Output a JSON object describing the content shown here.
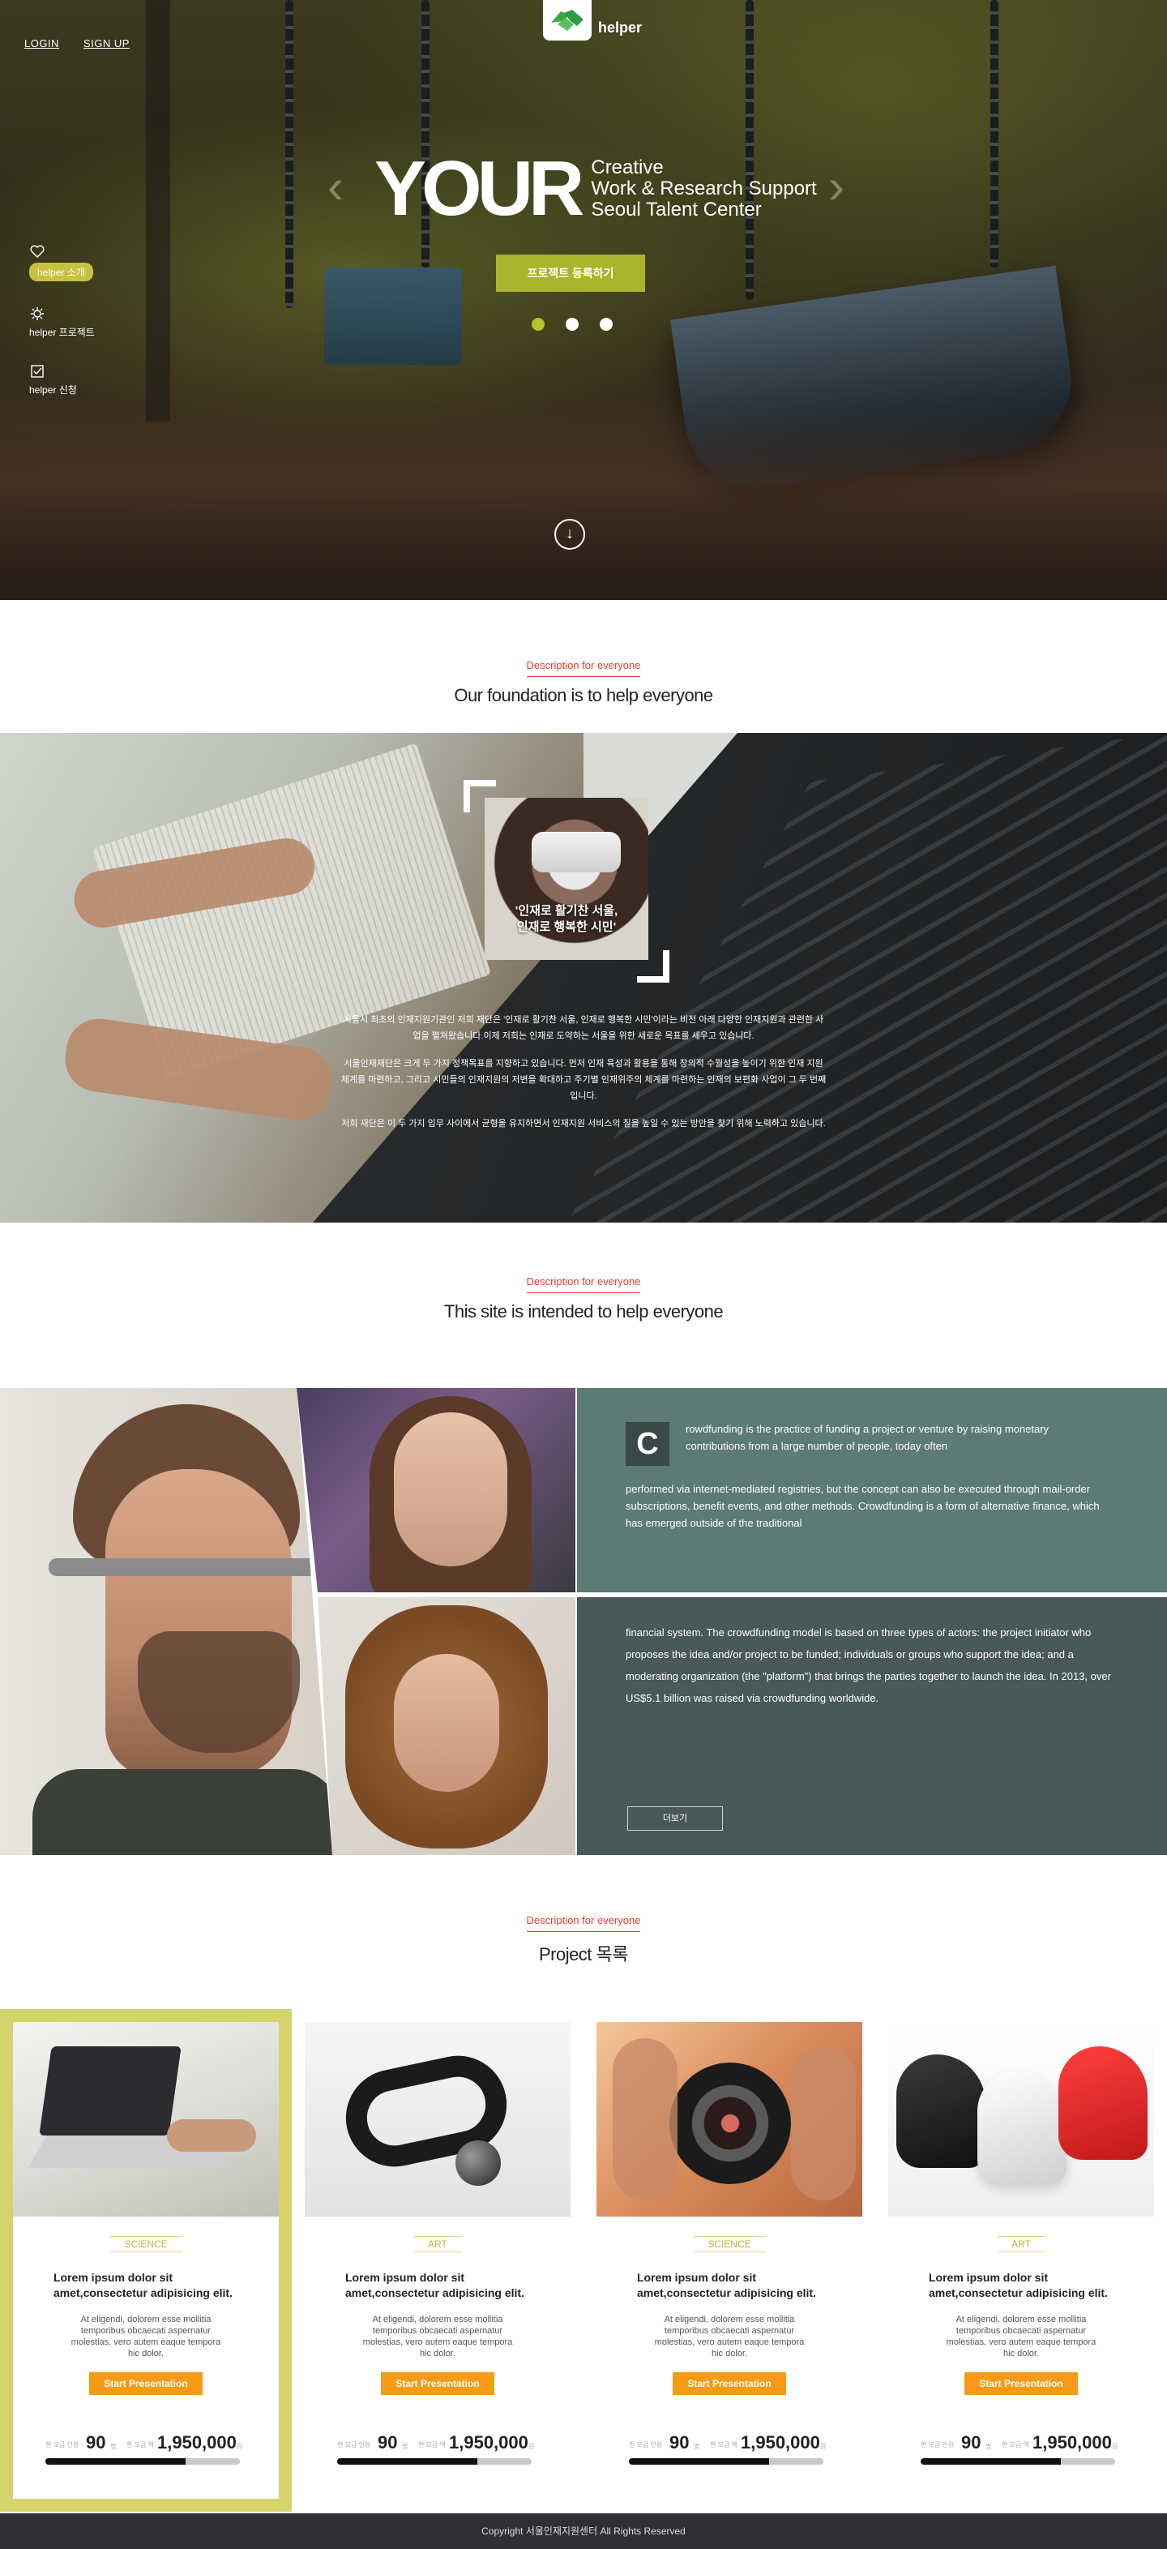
{
  "header": {
    "login": "LOGIN",
    "signup": "SIGN UP",
    "logo_text": "helper"
  },
  "side_nav": [
    {
      "label": "helper 소개",
      "icon": "heart-icon",
      "active": true
    },
    {
      "label": "helper 프로젝트",
      "icon": "gear-icon",
      "active": false
    },
    {
      "label": "helper 신청",
      "icon": "checkbox-icon",
      "active": false
    }
  ],
  "hero": {
    "big": "YOUR",
    "line1": "Creative",
    "line2": "Work & Research Support",
    "line3": "Seoul Talent Center",
    "cta": "프로젝트 등록하기",
    "prev_arrow": "‹",
    "next_arrow": "›",
    "scroll_icon": "↓",
    "active_slide": 1,
    "slide_count": 3
  },
  "section1": {
    "kicker": "Description for everyone",
    "title": "Our foundation is to help everyone",
    "photo_caption_line1": "'인재로 활기찬 서울,",
    "photo_caption_line2": "인재로 행복한 시민'",
    "paragraphs": [
      "서울시 최초의 인재지원기관인 저희 재단은 '인재로 활기찬 서울, 인재로 행복한 시민'이라는 비전 아래 다양한 인재지원과 관련한 사업을 펼쳐왔습니다.이제 저희는 인재로 도약하는 서울을 위한 새로운 목표를 세우고 있습니다.",
      "서울인재재단은 크게 두 가지 정책목표를 지향하고 있습니다. 먼저 인재 육성과 활용을 통해 창의적 수월성을 높이기 위한 인재 지원 체계를 마련하고, 그리고 시민들의 인재지원의 저변을 확대하고 주기별 인재위주의 체계를 마련하는 인재의 보편화 사업이 그 두 번째입니다.",
      "저희 재단은 이 두 가지 임무 사이에서 균형을 유지하면서 인재지원 서비스의 질을 높일 수 있는 방안을 찾기 위해 노력하고 있습니다."
    ]
  },
  "section2": {
    "kicker": "Description for everyone",
    "title": "This site is intended to help everyone",
    "drop_cap": "C",
    "lead": "rowdfunding is the practice of funding a project or venture by raising monetary contributions from a large number of people, today often",
    "rest": "performed via internet-mediated registries, but the concept can also be executed through mail-order subscriptions, benefit events, and other methods. Crowdfunding is a form of alternative finance, which has emerged outside of the traditional",
    "panel2": "financial system. The crowdfunding model is based on three types of actors: the project initiator who proposes the idea and/or project to be funded; individuals or groups who support the idea; and a moderating organization (the \"platform\") that brings the parties together to launch the idea. In 2013, over US$5.1 billion was raised via crowdfunding worldwide.",
    "more": "더보기"
  },
  "section3": {
    "kicker": "Description for everyone",
    "title": "Project 목록"
  },
  "projects": [
    {
      "tag": "SCIENCE",
      "title": "Lorem ipsum dolor sit amet,consectetur adipisicing elit.",
      "desc": "At eligendi, dolorem esse mollitia temporibus obcaecati aspernatur molestias, vero autem eaque tempora hic dolor.",
      "button": "Start Presentation",
      "label1": "현 모금 인원",
      "count": "90",
      "unit1": "명",
      "label2": "현 모금 액",
      "amount": "1,950,000",
      "unit2": "원",
      "progress": 0.72,
      "image": "laptop",
      "highlight": true
    },
    {
      "tag": "ART",
      "title": "Lorem ipsum dolor sit amet,consectetur adipisicing elit.",
      "desc": "At eligendi, dolorem esse mollitia temporibus obcaecati aspernatur molestias, vero autem eaque tempora hic dolor.",
      "button": "Start Presentation",
      "label1": "현 모금 인원",
      "count": "90",
      "unit1": "명",
      "label2": "현 모금 액",
      "amount": "1,950,000",
      "unit2": "원",
      "progress": 0.72,
      "image": "bracelet",
      "highlight": false
    },
    {
      "tag": "SCIENCE",
      "title": "Lorem ipsum dolor sit amet,consectetur adipisicing elit.",
      "desc": "At eligendi, dolorem esse mollitia temporibus obcaecati aspernatur molestias, vero autem eaque tempora hic dolor.",
      "button": "Start Presentation",
      "label1": "현 모금 인원",
      "count": "90",
      "unit1": "명",
      "label2": "현 모금 액",
      "amount": "1,950,000",
      "unit2": "원",
      "progress": 0.72,
      "image": "camera",
      "highlight": false
    },
    {
      "tag": "ART",
      "title": "Lorem ipsum dolor sit amet,consectetur adipisicing elit.",
      "desc": "At eligendi, dolorem esse mollitia temporibus obcaecati aspernatur molestias, vero autem eaque tempora hic dolor.",
      "button": "Start Presentation",
      "label1": "현 모금 인원",
      "count": "90",
      "unit1": "명",
      "label2": "현 모금 액",
      "amount": "1,950,000",
      "unit2": "원",
      "progress": 0.72,
      "image": "earbuds",
      "highlight": false
    }
  ],
  "footer": {
    "text": "Copyright 서울인재지원센터 All Rights Reserved"
  },
  "colors": {
    "accent_olive": "#aab42c",
    "kicker_red": "#e33c2c",
    "button_orange": "#f79a16",
    "panel_teal": "#5c7a76",
    "panel_dark": "#495858",
    "highlight_card": "#d5d36c"
  }
}
